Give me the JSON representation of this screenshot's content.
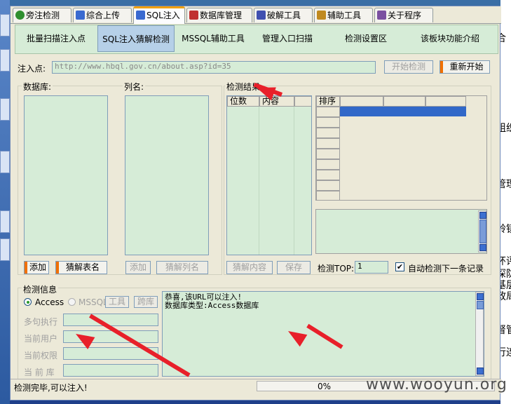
{
  "tabs": [
    {
      "label": "旁注检测",
      "color": "#2f8f2f"
    },
    {
      "label": "综合上传",
      "color": "#3a6ad0"
    },
    {
      "label": "SQL注入",
      "color": "#3a6ad0"
    },
    {
      "label": "数据库管理",
      "color": "#c03030"
    },
    {
      "label": "破解工具",
      "color": "#4050b0"
    },
    {
      "label": "辅助工具",
      "color": "#c08a20"
    },
    {
      "label": "关于程序",
      "color": "#7a4fa0"
    }
  ],
  "subtabs": [
    "批量扫描注入点",
    "SQL注入猜解检测",
    "MSSQL辅助工具",
    "管理入口扫描",
    "检测设置区",
    "该板块功能介绍"
  ],
  "inject": {
    "label": "注入点:",
    "url": "http://www.hbql.gov.cn/about.asp?id=35",
    "start_btn": "开始检测",
    "restart_btn": "重新开始"
  },
  "db": {
    "label": "数据库:",
    "add_btn": "添加",
    "guess_btn": "猜解表名"
  },
  "col": {
    "label": "列名:",
    "add_btn": "添加",
    "guess_btn": "猜解列名"
  },
  "results": {
    "label": "检测结果",
    "col_pos": "位数",
    "col_content": "内容",
    "sort_label": "排序",
    "guess_btn": "猜解内容",
    "save_btn": "保存",
    "top_label": "检测TOP:",
    "top_value": "1",
    "auto_label": "自动检测下一条记录"
  },
  "info": {
    "label": "检测信息",
    "access_label": "Access",
    "mssql_label": "MSSQL",
    "tools_btn": "工具",
    "cross_btn": "跨库",
    "multi_exec": "多句执行",
    "cur_user": "当前用户",
    "cur_priv": "当前权限",
    "cur_db": "当 前 库",
    "output_lines": [
      "恭喜,该URL可以注入!",
      "数据库类型:Access数据库"
    ]
  },
  "status": {
    "message": "检测完毕,可以注入!",
    "progress_text": "0%",
    "progress": 0
  },
  "watermark": "www.wooyun.org",
  "desktop_right_text": [
    "合",
    "组织",
    "管理",
    "铃镇",
    "环评",
    "深防",
    "基层",
    "政局",
    "督管",
    "行连"
  ]
}
